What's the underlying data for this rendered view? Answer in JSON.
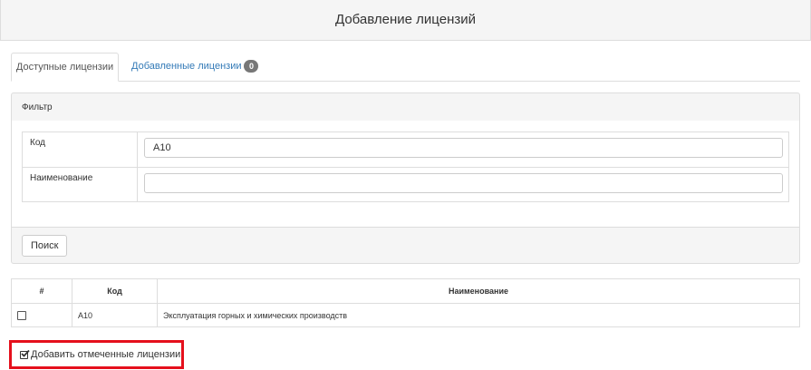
{
  "header": {
    "title": "Добавление лицензий"
  },
  "tabs": [
    {
      "label": "Доступные лицензии"
    },
    {
      "label": "Добавленные лицензии",
      "badge": "0"
    }
  ],
  "filter": {
    "title": "Фильтр",
    "fields": [
      {
        "label": "Код",
        "value": "A10"
      },
      {
        "label": "Наименование",
        "value": ""
      }
    ],
    "search_label": "Поиск"
  },
  "results": {
    "columns": [
      "#",
      "Код",
      "Наименование"
    ],
    "rows": [
      {
        "checked": false,
        "code": "A10",
        "name": "Эксплуатация горных и химических производств"
      }
    ]
  },
  "add_button": {
    "label": "Добавить отмеченные лицензии",
    "icon": "check-square-icon"
  },
  "colors": {
    "highlight": "#e5101c",
    "link": "#337ab7",
    "badge": "#777777"
  }
}
